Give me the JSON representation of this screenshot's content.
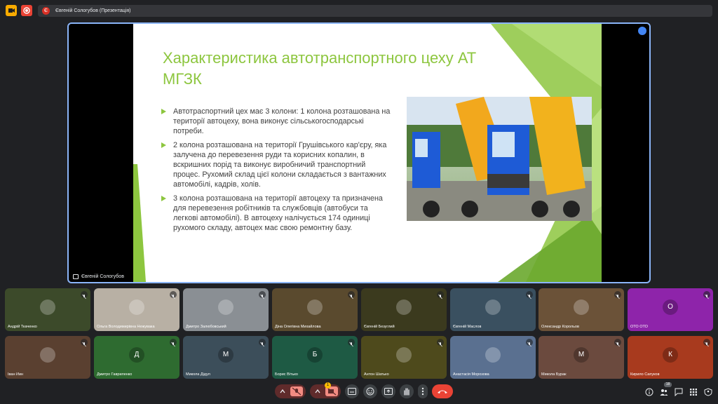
{
  "window": {
    "title": "Євгеній Сологубов (Презентація)",
    "title_badge": "Є"
  },
  "presentation": {
    "presenter_label": "Євгеній Сологубов",
    "slide": {
      "title": "Характеристика автотранспортного цеху АТ МГЗК",
      "bullets": [
        "Автотраспортний цех має 3 колони: 1 колона розташована на території автоцеху, вона виконує сільськогосподарські потреби.",
        "2 колона розташована на території Грушівського кар'єру, яка залучена до перевезення руди та корисних копалин, в вскришних порід та виконує виробничий транспортний процес. Рухомий склад цієї колони складається з вантажних автомобілі, кадрів, холів.",
        "3 колона розташована на території автоцеху та призначена для перевезення робітників та службовців (автобуси та легкові автомобілі). В автоцеху налічується 174 одиниці рухомого складу, автоцех має свою ремонтну базу."
      ]
    }
  },
  "participants": [
    {
      "name": "Андрій Ткаченко",
      "bg": "#3c4a2a",
      "avatar": ""
    },
    {
      "name": "Ольга Володимирівна Нежувака",
      "bg": "#b8b0a4",
      "avatar": ""
    },
    {
      "name": "Дмитро Залюбовський",
      "bg": "#8a8f94",
      "avatar": ""
    },
    {
      "name": "Діна Олегівна Михайлова",
      "bg": "#5a4a2e",
      "avatar": ""
    },
    {
      "name": "Євгеній Безуглий",
      "bg": "#3b3a1e",
      "avatar": ""
    },
    {
      "name": "Євгеній Маслов",
      "bg": "#3a5060",
      "avatar": ""
    },
    {
      "name": "Олександр Корольов",
      "bg": "#6b5238",
      "avatar": ""
    },
    {
      "name": "ОТО ОТО",
      "bg": "#8e24aa",
      "avatar": "О"
    },
    {
      "name": "Іван Иин",
      "bg": "#5a4030",
      "avatar": ""
    },
    {
      "name": "Дмитро Гавриленко",
      "bg": "#2e6b30",
      "avatar": "Д"
    },
    {
      "name": "Микола Дідул",
      "bg": "#3c4e5a",
      "avatar": "М"
    },
    {
      "name": "Борис Вітько",
      "bg": "#1e5a44",
      "avatar": "Б"
    },
    {
      "name": "Антон Шатько",
      "bg": "#4e4a1c",
      "avatar": ""
    },
    {
      "name": "Анастасія Морозова",
      "bg": "#5a7090",
      "avatar": ""
    },
    {
      "name": "Микола Бурак",
      "bg": "#6b4a3e",
      "avatar": "М"
    },
    {
      "name": "Кирило Сапуков",
      "bg": "#a83a1e",
      "avatar": "К"
    }
  ],
  "toolbar": {
    "participants_count": "18",
    "raise_hand_badge": "1"
  },
  "colors": {
    "accent": "#8dc63f",
    "end_call": "#ea4335",
    "stage_border": "#8ab4f8"
  }
}
